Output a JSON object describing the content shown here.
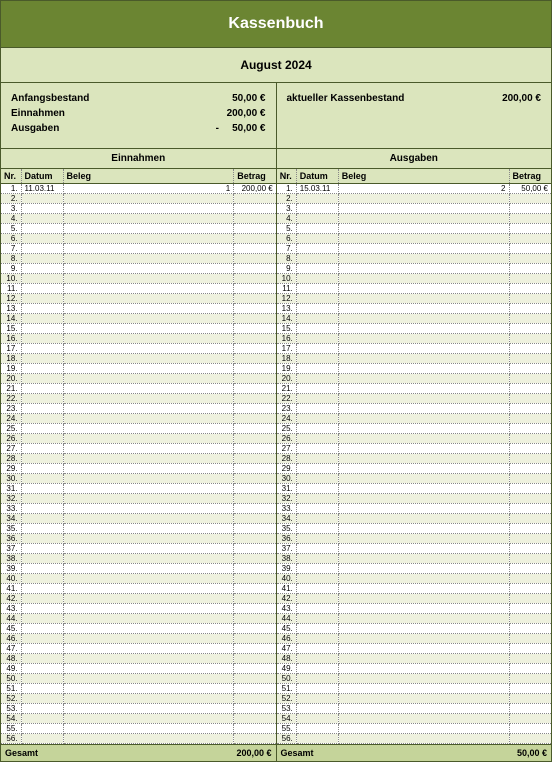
{
  "title": "Kassenbuch",
  "period": "August 2024",
  "summary": {
    "anfangsbestand_label": "Anfangsbestand",
    "anfangsbestand": "50,00 €",
    "einnahmen_label": "Einnahmen",
    "einnahmen": "200,00 €",
    "ausgaben_label": "Ausgaben",
    "ausgaben_prefix": "-",
    "ausgaben": "50,00 €",
    "aktuell_label": "aktueller Kassenbestand",
    "aktuell": "200,00 €"
  },
  "sections": {
    "einnahmen": "Einnahmen",
    "ausgaben": "Ausgaben"
  },
  "columns": {
    "nr": "Nr.",
    "datum": "Datum",
    "beleg": "Beleg",
    "betrag": "Betrag"
  },
  "einnahmen_rows": [
    {
      "datum": "11.03.11",
      "beleg": "1",
      "betrag": "200,00 €"
    }
  ],
  "ausgaben_rows": [
    {
      "datum": "15.03.11",
      "beleg": "2",
      "betrag": "50,00 €"
    }
  ],
  "row_count": 56,
  "totals": {
    "label": "Gesamt",
    "einnahmen": "200,00 €",
    "ausgaben": "50,00 €"
  }
}
